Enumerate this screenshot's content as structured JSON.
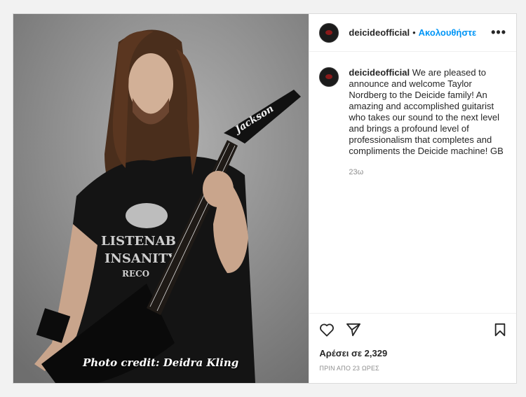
{
  "post": {
    "username": "deicideofficial",
    "follow_label": "Ακολουθήστε",
    "separator": "•",
    "more_label": "•••",
    "caption": "We are pleased to announce and welcome Taylor Nordberg to the Deicide family! An amazing and accomplished guitarist who takes our sound to the next level and brings a profound level of professionalism that completes and compliments the Deicide machine! GB",
    "caption_time": "23ω",
    "likes": "Αρέσει σε 2,329",
    "posted_ago": "ΠΡΙΝ ΑΠΟ 23 ΩΡΕΣ"
  },
  "media": {
    "credit": "Photo credit: Deidra Kling",
    "shirt_text": [
      "LISTENAB",
      "INSANITY",
      "RECO"
    ],
    "headstock_brand": "Jackson"
  },
  "icons": {
    "like": "heart-icon",
    "share": "paper-plane-icon",
    "save": "bookmark-icon",
    "more": "ellipsis-icon"
  },
  "colors": {
    "accent": "#0095f6",
    "text": "#262626",
    "muted": "#8e8e8e"
  }
}
